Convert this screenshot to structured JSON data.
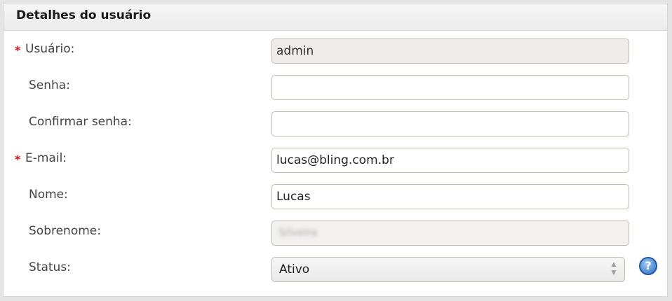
{
  "panel": {
    "title": "Detalhes do usuário"
  },
  "form": {
    "required_marker": "*",
    "usuario": {
      "label": "Usuário:",
      "value": "admin"
    },
    "senha": {
      "label": "Senha:",
      "value": ""
    },
    "confirmar_senha": {
      "label": "Confirmar senha:",
      "value": ""
    },
    "email": {
      "label": "E-mail:",
      "value": "lucas@bling.com.br"
    },
    "nome": {
      "label": "Nome:",
      "value": "Lucas"
    },
    "sobrenome": {
      "label": "Sobrenome:",
      "value": "Silveira"
    },
    "status": {
      "label": "Status:",
      "value": "Ativo"
    }
  },
  "icons": {
    "help": "help-icon"
  }
}
